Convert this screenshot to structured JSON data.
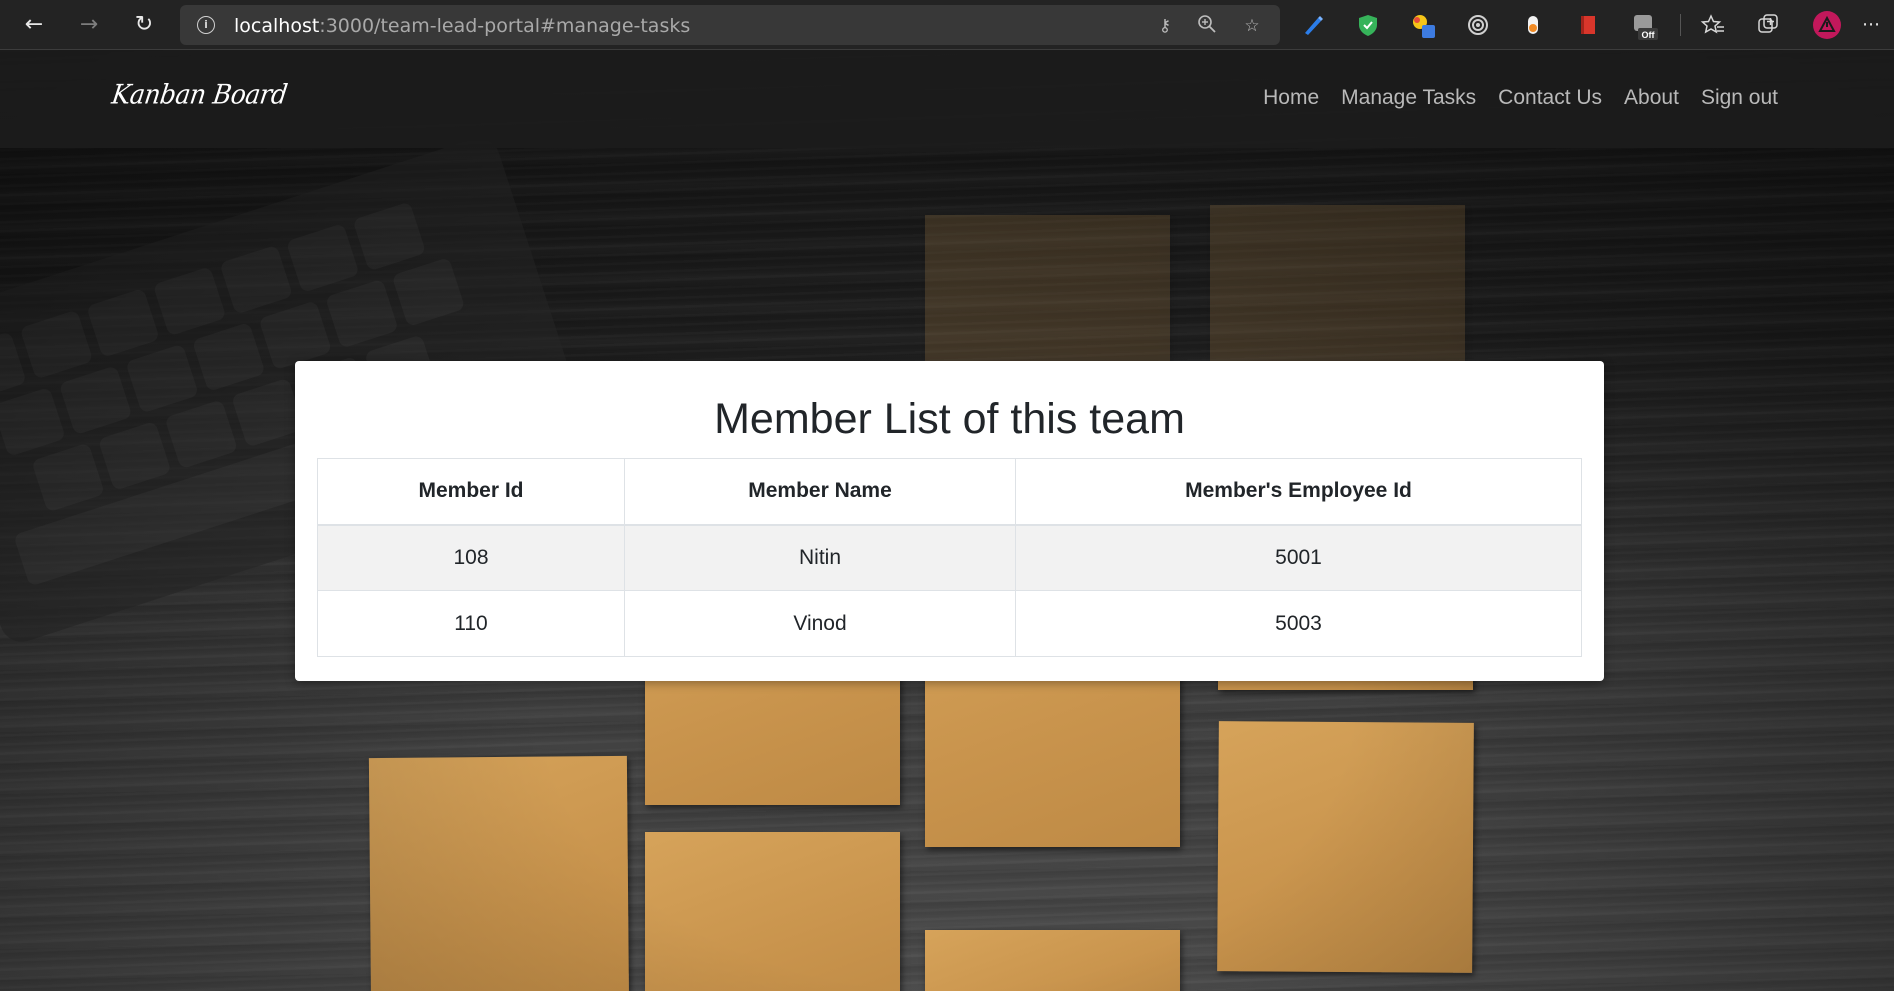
{
  "browser": {
    "url_host": "localhost",
    "url_rest": ":3000/team-lead-portal#manage-tasks",
    "extension_badge": "Off"
  },
  "navbar": {
    "brand": "Kanban Board",
    "links": [
      "Home",
      "Manage Tasks",
      "Contact Us",
      "About",
      "Sign out"
    ]
  },
  "card": {
    "title": "Member List of this team",
    "columns": [
      "Member Id",
      "Member Name",
      "Member's Employee Id"
    ],
    "rows": [
      [
        "108",
        "Nitin",
        "5001"
      ],
      [
        "110",
        "Vinod",
        "5003"
      ]
    ]
  },
  "colors": {
    "navbar_bg": "#1c1c1c",
    "sticky_note": "#cf9a52",
    "card_bg": "#ffffff",
    "striped_row": "#f2f2f2"
  }
}
